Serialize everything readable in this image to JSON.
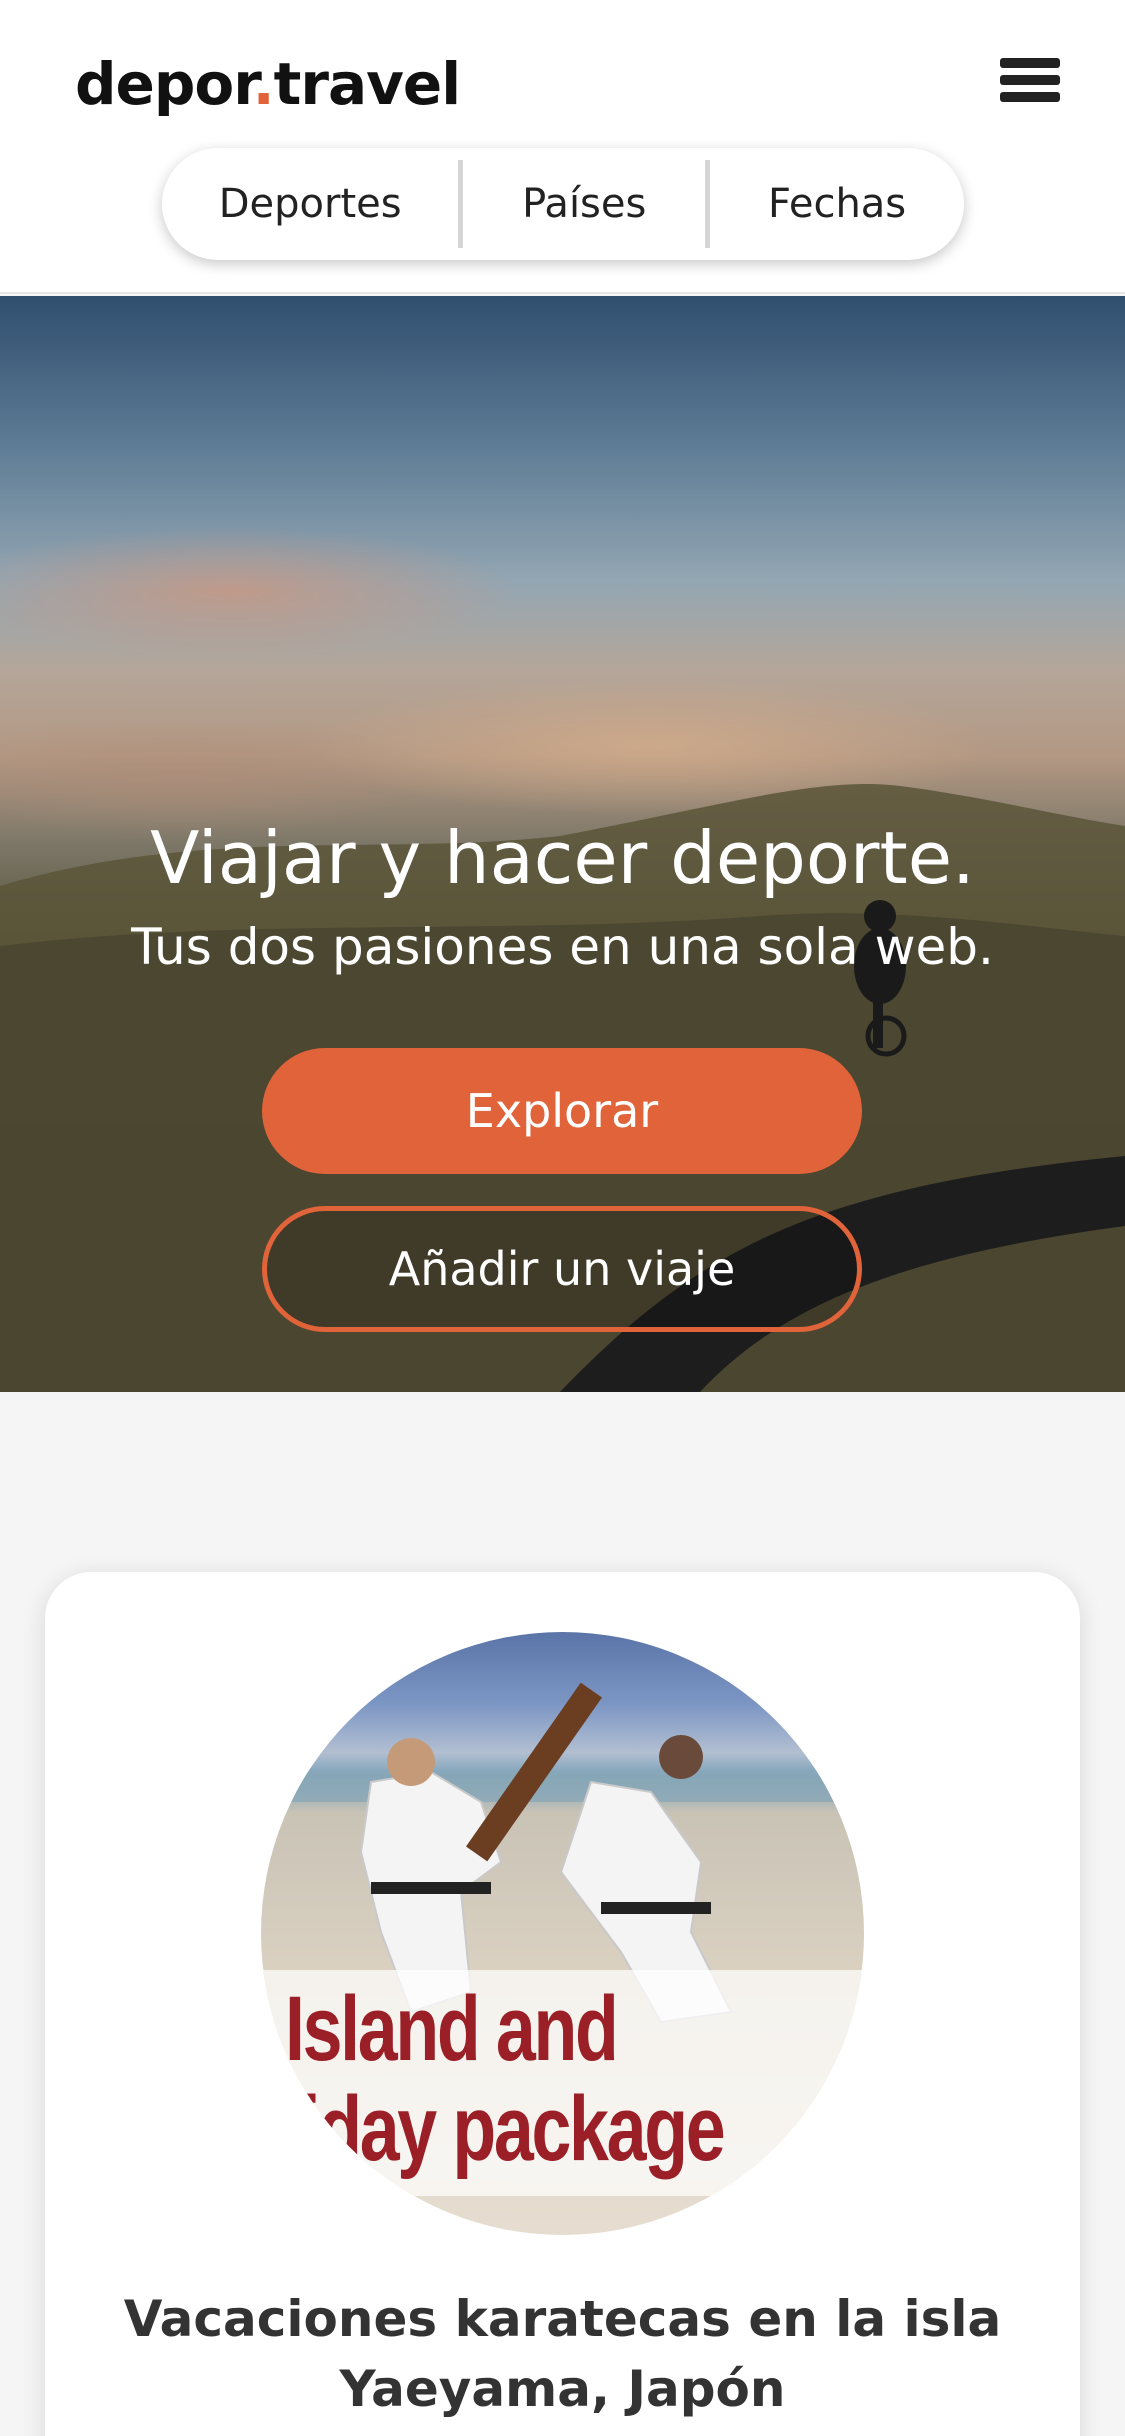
{
  "header": {
    "logo_main": "depor",
    "logo_dot": ".",
    "logo_tail": "travel",
    "menu_icon": "hamburger-menu-icon"
  },
  "nav_tabs": [
    {
      "label": "Deportes"
    },
    {
      "label": "Países"
    },
    {
      "label": "Fechas"
    }
  ],
  "hero": {
    "title": "Viajar y hacer deporte.",
    "subtitle": "Tus dos pasiones en una sola web.",
    "primary_button": "Explorar",
    "secondary_button": "Añadir un viaje"
  },
  "card": {
    "image_text_line1": "Island and",
    "image_text_line2": "liday package",
    "title": "Vacaciones karatecas en la isla Yaeyama, Japón"
  },
  "colors": {
    "accent": "#e0633a",
    "text_dark": "#222222",
    "page_bg": "#f5f5f5"
  }
}
